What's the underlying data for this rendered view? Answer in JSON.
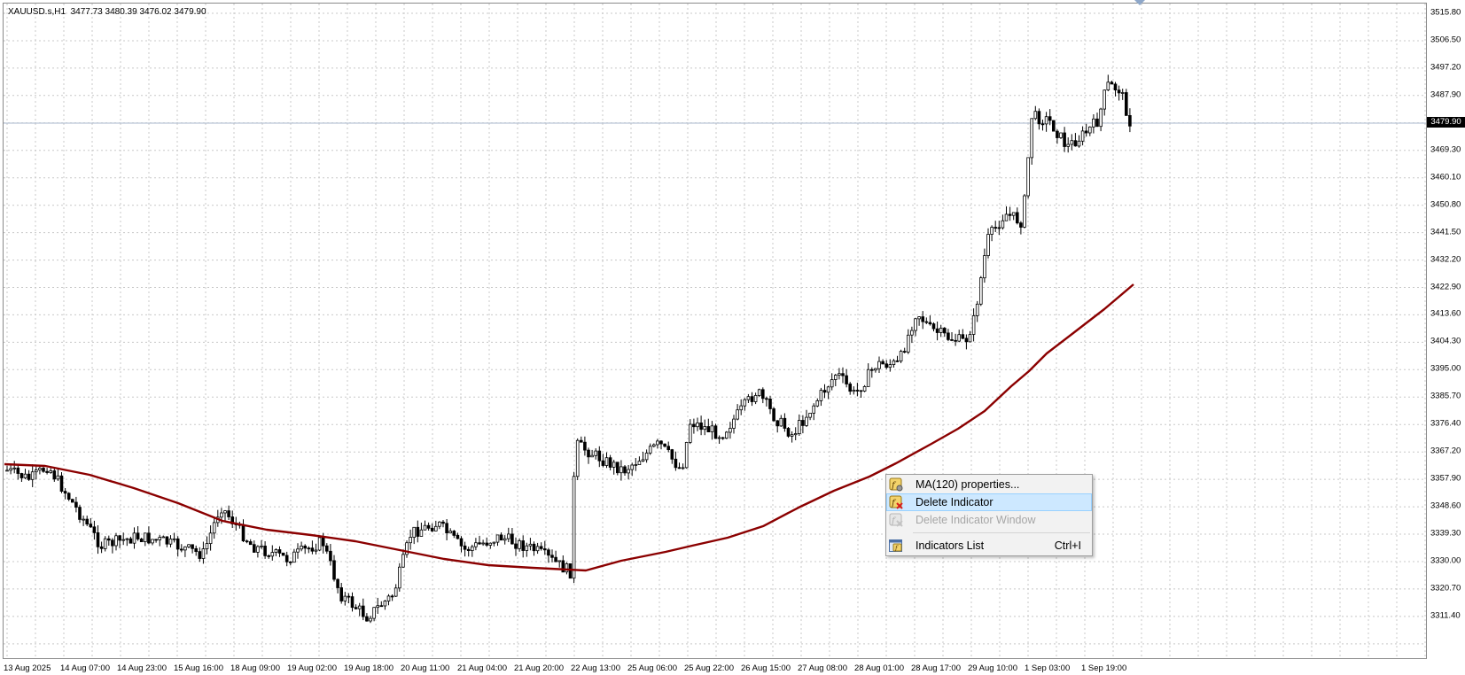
{
  "symbol": {
    "name": "XAUUSD.s,H1",
    "open": "3477.73",
    "high": "3480.39",
    "low": "3476.02",
    "close": "3479.90"
  },
  "price_axis": {
    "labels": [
      "3515.80",
      "3506.50",
      "3497.20",
      "3487.90",
      "3469.30",
      "3460.10",
      "3450.80",
      "3441.50",
      "3432.20",
      "3422.90",
      "3413.60",
      "3404.30",
      "3395.00",
      "3385.70",
      "3376.40",
      "3367.20",
      "3357.90",
      "3348.60",
      "3339.30",
      "3330.00",
      "3320.70",
      "3311.40"
    ],
    "current_price": "3479.90"
  },
  "time_axis": {
    "labels": [
      "13 Aug 2025",
      "14 Aug 07:00",
      "14 Aug 23:00",
      "15 Aug 16:00",
      "18 Aug 09:00",
      "19 Aug 02:00",
      "19 Aug 18:00",
      "20 Aug 11:00",
      "21 Aug 04:00",
      "21 Aug 20:00",
      "22 Aug 13:00",
      "25 Aug 06:00",
      "25 Aug 22:00",
      "26 Aug 15:00",
      "27 Aug 08:00",
      "28 Aug 01:00",
      "28 Aug 17:00",
      "29 Aug 10:00",
      "1 Sep 03:00",
      "1 Sep 19:00"
    ]
  },
  "indicator": {
    "name": "MA(120)",
    "color": "#8b0000"
  },
  "colors": {
    "grid": "#c8c8c8",
    "candle_bull": "#ffffff",
    "candle_bear": "#000000",
    "bid_line": "#a9b7cc",
    "menu_highlight": "#cde8ff"
  },
  "context_menu": {
    "items": [
      {
        "label": "MA(120) properties...",
        "icon": "indicator-properties-icon",
        "state": "normal"
      },
      {
        "label": "Delete Indicator",
        "icon": "delete-indicator-icon",
        "state": "highlighted"
      },
      {
        "label": "Delete Indicator Window",
        "icon": "delete-window-icon",
        "state": "disabled"
      },
      {
        "label": "Indicators List",
        "icon": "indicators-list-icon",
        "shortcut": "Ctrl+I",
        "state": "normal"
      }
    ]
  }
}
